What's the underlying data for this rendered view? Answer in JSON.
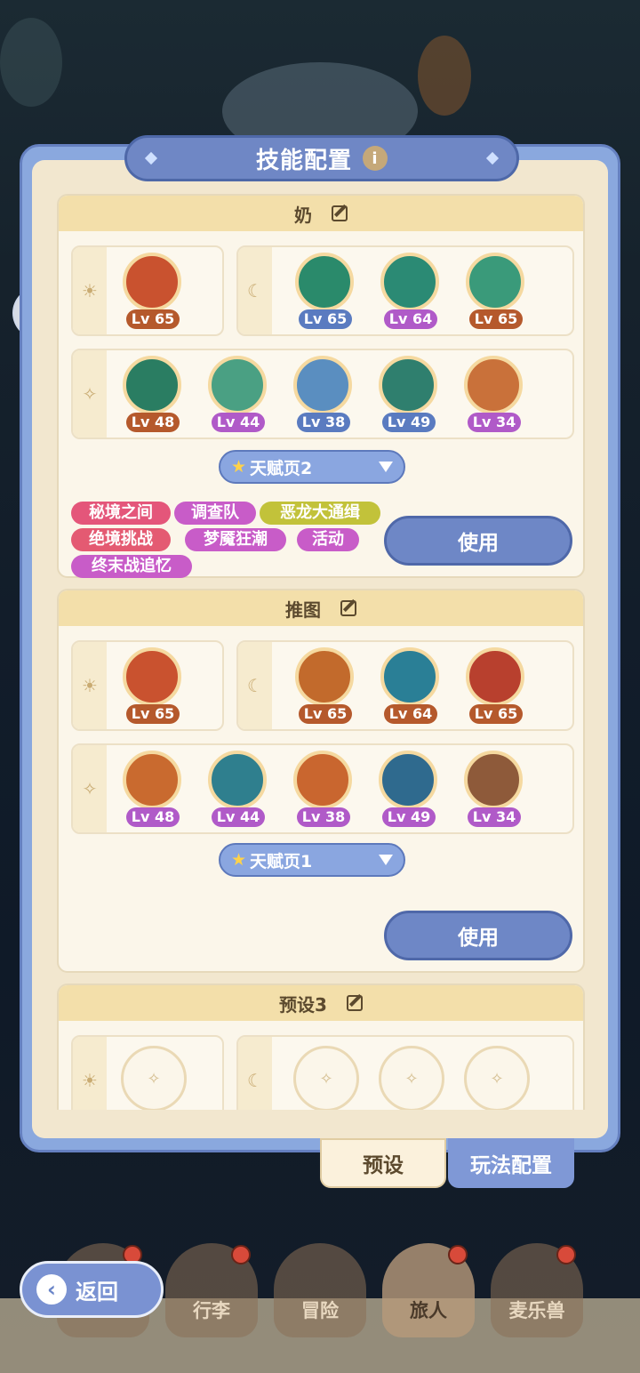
{
  "title": "技能配置",
  "info_icon": "i",
  "presets": [
    {
      "name": "奶",
      "sun_skills": [
        {
          "lv": "Lv 65",
          "color": "#c9522f"
        }
      ],
      "moon_skills": [
        {
          "lv": "Lv 65",
          "color": "#2a8a6b"
        },
        {
          "lv": "Lv 64",
          "color": "#2b8a74"
        },
        {
          "lv": "Lv 65",
          "color": "#3a9a7a"
        }
      ],
      "star_skills": [
        {
          "lv": "Lv 48",
          "color": "#2a7d62"
        },
        {
          "lv": "Lv 44",
          "color": "#4aa083"
        },
        {
          "lv": "Lv 38",
          "color": "#5a8ec0"
        },
        {
          "lv": "Lv 49",
          "color": "#2f7f6e"
        },
        {
          "lv": "Lv 34",
          "color": "#c9713a"
        }
      ],
      "talent_page": "天赋页2",
      "tags": [
        {
          "label": "秘境之间",
          "color": "#e4567a"
        },
        {
          "label": "调查队",
          "color": "#c85cc8"
        },
        {
          "label": "恶龙大通缉",
          "color": "#c2c23a"
        },
        {
          "label": "绝境挑战",
          "color": "#e45a72"
        },
        {
          "label": "梦魇狂潮",
          "color": "#c85cc8"
        },
        {
          "label": "活动",
          "color": "#c85cc8"
        },
        {
          "label": "终末战追忆",
          "color": "#c85cc8"
        }
      ],
      "use_label": "使用"
    },
    {
      "name": "推图",
      "sun_skills": [
        {
          "lv": "Lv 65",
          "color": "#c9522f"
        }
      ],
      "moon_skills": [
        {
          "lv": "Lv 65",
          "color": "#c26a2c"
        },
        {
          "lv": "Lv 64",
          "color": "#2a7f96"
        },
        {
          "lv": "Lv 65",
          "color": "#b8402e"
        }
      ],
      "star_skills": [
        {
          "lv": "Lv 48",
          "color": "#c96a2f"
        },
        {
          "lv": "Lv 44",
          "color": "#2f7f8e"
        },
        {
          "lv": "Lv 38",
          "color": "#c9662f"
        },
        {
          "lv": "Lv 49",
          "color": "#2f6a8e"
        },
        {
          "lv": "Lv 34",
          "color": "#8e5a3a"
        }
      ],
      "talent_page": "天赋页1",
      "use_label": "使用"
    },
    {
      "name": "预设3"
    }
  ],
  "bottom_tabs": {
    "preset": "预设",
    "gameplay": "玩法配置"
  },
  "nav": {
    "back": "返回",
    "bag": "行李",
    "adventure": "冒险",
    "traveler": "旅人",
    "pet": "麦乐兽"
  },
  "colors": {
    "lv_brown": "#b5592c",
    "lv_blue": "#5a7bc0",
    "lv_purple": "#b05ac8"
  },
  "icons": {
    "sun": "sun-icon",
    "moon": "moon-icon",
    "star": "star-icon",
    "edit": "edit-icon",
    "chat": "chat-icon"
  }
}
